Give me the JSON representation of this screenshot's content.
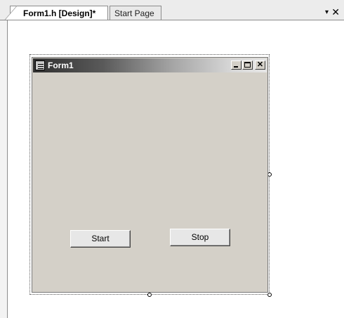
{
  "tabs": [
    {
      "label": "Form1.h [Design]*",
      "active": true
    },
    {
      "label": "Start Page",
      "active": false
    }
  ],
  "tab_controls": {
    "dropdown_glyph": "▾",
    "close_glyph": "✕"
  },
  "form": {
    "title": "Form1",
    "icon": "form-app-icon",
    "caption_buttons": {
      "minimize": "",
      "maximize": "",
      "close": "✕"
    },
    "buttons": {
      "start_label": "Start",
      "stop_label": "Stop"
    }
  },
  "colors": {
    "form_background": "#d4d0c8",
    "surface_background": "#ffffff"
  }
}
